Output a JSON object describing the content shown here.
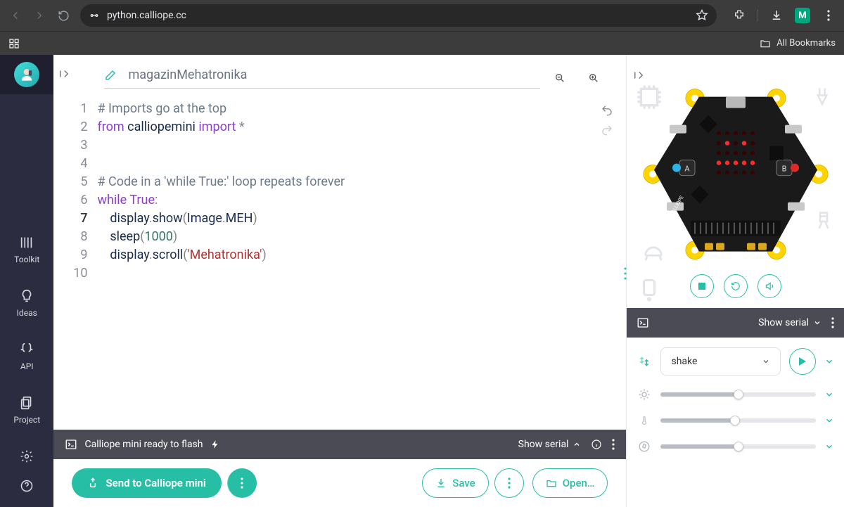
{
  "browser": {
    "url": "python.calliope.cc",
    "all_bookmarks": "All Bookmarks"
  },
  "rail": {
    "toolkit": "Toolkit",
    "ideas": "Ideas",
    "api": "API",
    "project": "Project"
  },
  "project_name": "magazinMehatronika",
  "code": {
    "lines": [
      "# Imports go at the top",
      "from calliopemini import *",
      "",
      "",
      "# Code in a 'while True:' loop repeats forever",
      "while True:",
      "    display.show(Image.MEH)",
      "    sleep(1000)",
      "    display.scroll('Mehatronika')",
      ""
    ],
    "current_line": 7
  },
  "status": {
    "ready": "Calliope mini ready to flash",
    "show_serial": "Show serial"
  },
  "actions": {
    "send": "Send to Calliope mini",
    "save": "Save",
    "open": "Open…"
  },
  "serial_panel": {
    "show_serial": "Show serial",
    "gesture": "shake",
    "light_pct": 50,
    "temp_pct": 48,
    "compass_pct": 50
  }
}
